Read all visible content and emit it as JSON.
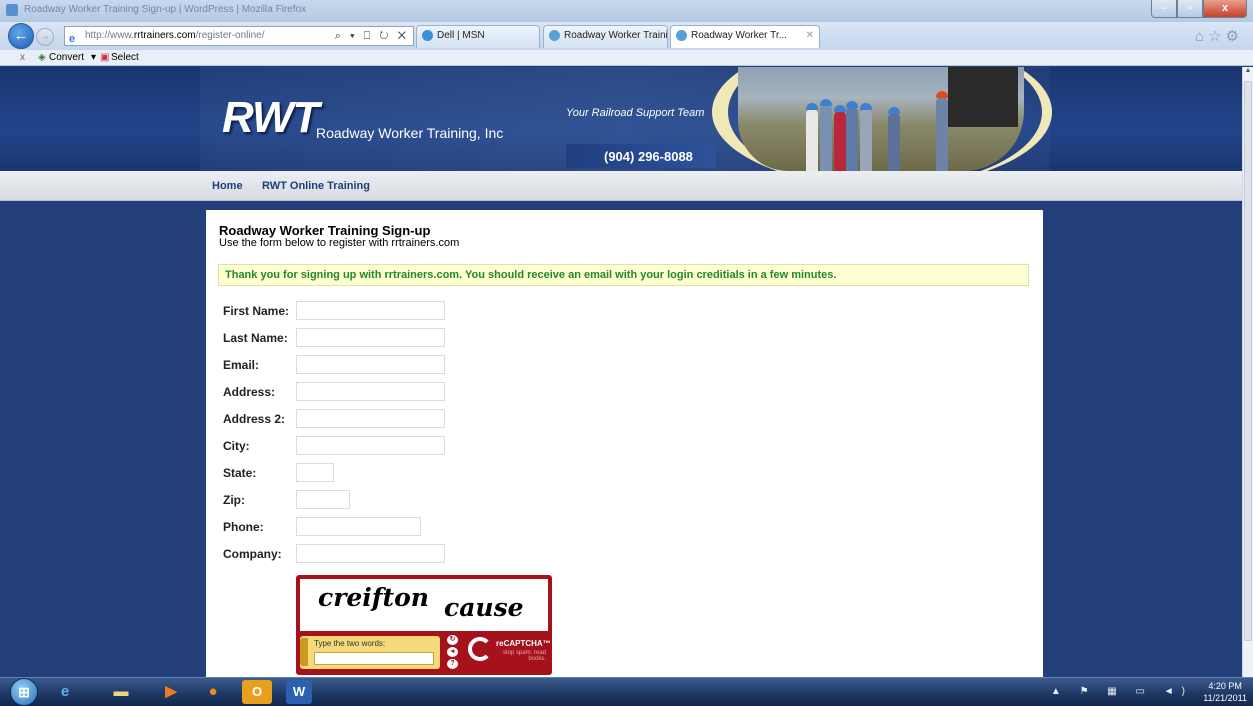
{
  "window": {
    "title": "Roadway Worker Training Sign-up | WordPress | Mozilla Firefox"
  },
  "browser": {
    "address_prefix": "http://www.",
    "address_host": "rrtrainers.com",
    "address_path": "/register-online/",
    "address_controls": "⌕ ▾ ⎕ ↻ ✕",
    "tabs": [
      {
        "label": "Dell | MSN"
      },
      {
        "label": "Roadway Worker Traini..."
      },
      {
        "label": "Roadway Worker Tr..."
      }
    ],
    "command_bar": {
      "close": "x",
      "convert": "Convert",
      "convert_arrow": "▾",
      "select": "Select"
    }
  },
  "banner": {
    "logo": "RWT",
    "logo_sub": "Roadway Worker Training, Inc",
    "tagline": "Your Railroad Support Team",
    "phone": "(904) 296-8088"
  },
  "menu": {
    "home": "Home",
    "online_training": "RWT Online Training"
  },
  "content": {
    "title": "Roadway Worker Training Sign-up",
    "subtitle": "Use the form below to register with rrtrainers.com",
    "notice": "Thank you for signing up with rrtrainers.com. You should receive an email with your login creditials in a few minutes.",
    "fields": {
      "first_name": "First Name:",
      "last_name": "Last Name:",
      "email": "Email:",
      "address": "Address:",
      "address2": "Address 2:",
      "city": "City:",
      "state": "State:",
      "zip": "Zip:",
      "phone": "Phone:",
      "company": "Company:"
    },
    "captcha": {
      "word1": "creifton",
      "word2": "cause",
      "prompt": "Type the two words:",
      "brand": "reCAPTCHA™",
      "slogan": "stop spam. read books."
    }
  },
  "taskbar": {
    "time": "4:20 PM",
    "date": "11/21/2011",
    "word_label": "W",
    "outlook_label": "O",
    "tray_icons": "▲ ⚑ ▦ ▭ ◄)"
  }
}
